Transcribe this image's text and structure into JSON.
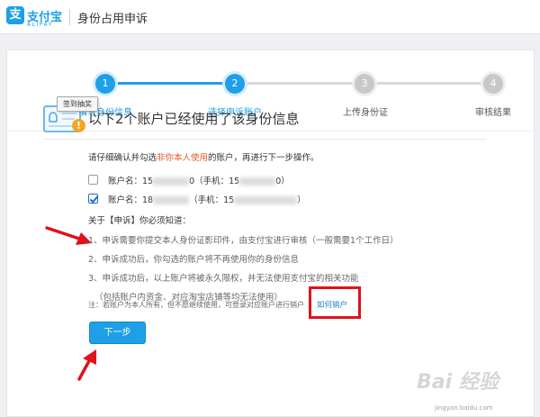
{
  "header": {
    "logo_cn": "支付宝",
    "logo_en": "ALIPAY",
    "title": "身份占用申诉"
  },
  "steps": [
    {
      "number": "1",
      "label": "填写身份信息",
      "state": "done"
    },
    {
      "number": "2",
      "label": "选择申诉账户",
      "state": "current"
    },
    {
      "number": "3",
      "label": "上传身份证",
      "state": "todo"
    },
    {
      "number": "4",
      "label": "审核结果",
      "state": "todo"
    }
  ],
  "tooltip": "签到抽奖",
  "main": {
    "heading": "以下2个账户已经使用了该身份信息",
    "instruction_prefix": "请仔细确认并勾选",
    "instruction_highlight": "非你本人使用",
    "instruction_suffix": "的账户，再进行下一步操作。",
    "accounts": [
      {
        "prefix": "账户名：15",
        "mid": "0（手机：15",
        "suffix": "0）",
        "checked": false
      },
      {
        "prefix": "账户名：18",
        "mid": "（手机：15",
        "suffix": "）",
        "checked": true
      }
    ]
  },
  "notice": {
    "title": "关于【申诉】你必须知道：",
    "items": [
      "1、申诉需要你提交本人身份证影印件，由支付宝进行审核（一般需要1个工作日）",
      "2、申诉成功后，你勾选的账户将不再使用你的身份信息",
      "3、申诉成功后，以上账户将被永久限权，并无法使用支付宝的相关功能",
      "（包括账户内资金、对应淘宝店铺等均无法使用）"
    ],
    "footnote": "注：若账户为本人所有，但不愿继续使用，可登录对应账户进行销户",
    "link": "如何销户"
  },
  "buttons": {
    "next": "下一步"
  },
  "watermark": {
    "brand": "Bai 经验",
    "sub": "jingyan.baidu.com"
  },
  "colors": {
    "accent": "#1e9fe8",
    "highlight": "#e4572b",
    "annotation": "#e0121b"
  }
}
